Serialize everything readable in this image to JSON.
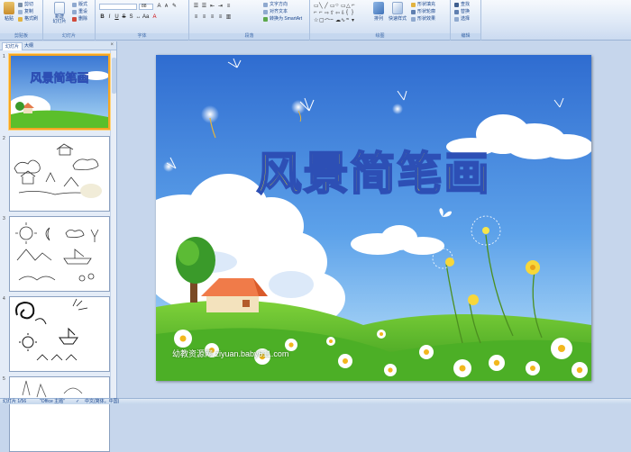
{
  "ribbon": {
    "clipboard": {
      "paste": "粘贴",
      "cut": "剪切",
      "copy": "复制",
      "format_painter": "格式刷",
      "label": "剪贴板"
    },
    "slides": {
      "new_slide": "新建\n幻灯片",
      "layout": "版式",
      "reset": "重设",
      "delete": "删除",
      "label": "幻灯片"
    },
    "font": {
      "font_name": "",
      "font_size": "88",
      "label": "字体"
    },
    "paragraph": {
      "label": "段落",
      "text_direction": "文字方向",
      "align_text": "对齐文本",
      "smartart": "转换为 SmartArt"
    },
    "drawing": {
      "arrange": "排列",
      "quick_styles": "快速样式",
      "shape_fill": "形状填充",
      "shape_outline": "形状轮廓",
      "shape_effects": "形状效果",
      "label": "绘图"
    },
    "editing": {
      "find": "查找",
      "replace": "替换",
      "select": "选择",
      "label": "编辑"
    }
  },
  "panel": {
    "tab_slides": "幻灯片",
    "tab_outline": "大纲",
    "thumbnails": [
      {
        "num": "1",
        "title": "风景简笔画"
      },
      {
        "num": "2"
      },
      {
        "num": "3"
      },
      {
        "num": "4"
      },
      {
        "num": "5"
      }
    ]
  },
  "slide": {
    "title": "风景简笔画",
    "watermark": "幼教资源网 ziyuan.baby611.com"
  },
  "status": {
    "slide_counter": "幻灯片 1/56",
    "theme": "\"Office 主题\"",
    "language": "中文(简体，中国)"
  },
  "colors": {
    "title_fill": "#f7ea16",
    "title_stroke": "#2d4fb5",
    "sky_top": "#3b78d4",
    "grass": "#5bbf2b"
  }
}
